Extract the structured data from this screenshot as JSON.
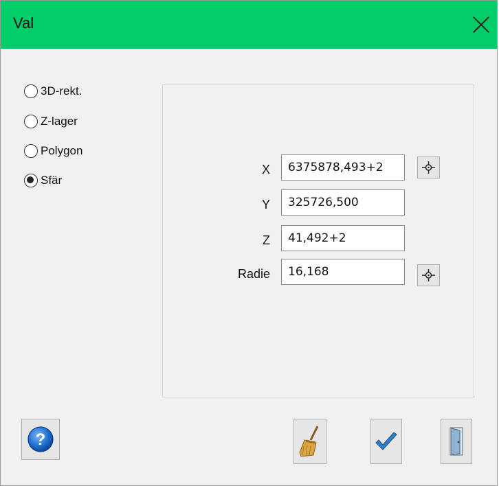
{
  "window": {
    "title": "Val",
    "titlebar_color": "#00cc6a"
  },
  "selection_type": {
    "options": [
      {
        "label": "3D-rekt.",
        "checked": false
      },
      {
        "label": "Z-lager",
        "checked": false
      },
      {
        "label": "Polygon",
        "checked": false
      },
      {
        "label": "Sfär",
        "checked": true
      }
    ]
  },
  "fields": {
    "x": {
      "label": "X",
      "value": "6375878,493+2"
    },
    "y": {
      "label": "Y",
      "value": "325726,500"
    },
    "z": {
      "label": "Z",
      "value": "41,492+2"
    },
    "radie": {
      "label": "Radie",
      "value": "16,168"
    }
  },
  "icons": {
    "help": "question-mark-icon",
    "pick": "crosshair-icon",
    "clear": "broom-icon",
    "ok": "checkmark-icon",
    "exit": "door-icon"
  },
  "colors": {
    "help_blue": "#1f6fd0",
    "check_blue": "#2f7ec9",
    "accent_green": "#00cc6a"
  }
}
